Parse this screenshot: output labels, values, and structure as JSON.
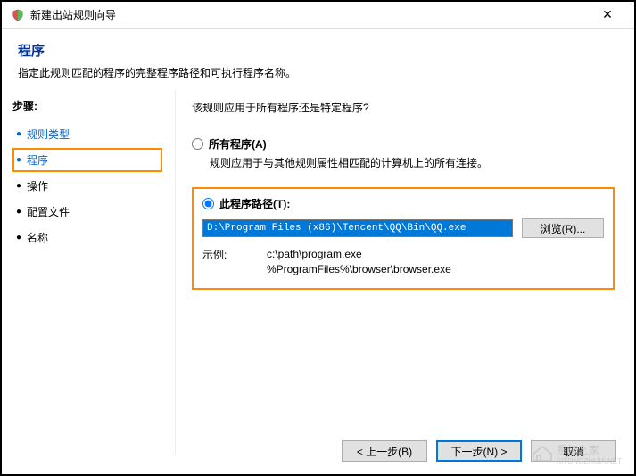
{
  "titlebar": {
    "title": "新建出站规则向导",
    "close": "✕"
  },
  "header": {
    "title": "程序",
    "description": "指定此规则匹配的程序的完整程序路径和可执行程序名称。"
  },
  "sidebar": {
    "title": "步骤:",
    "items": [
      {
        "label": "规则类型",
        "active": false,
        "link": true
      },
      {
        "label": "程序",
        "active": true,
        "link": true
      },
      {
        "label": "操作",
        "active": false,
        "link": false
      },
      {
        "label": "配置文件",
        "active": false,
        "link": false
      },
      {
        "label": "名称",
        "active": false,
        "link": false
      }
    ]
  },
  "main": {
    "question": "该规则应用于所有程序还是特定程序?",
    "optionAll": {
      "label": "所有程序(A)",
      "desc": "规则应用于与其他规则属性相匹配的计算机上的所有连接。"
    },
    "optionPath": {
      "label": "此程序路径(T):",
      "value": "D:\\Program Files (x86)\\Tencent\\QQ\\Bin\\QQ.exe",
      "browse": "浏览(R)...",
      "exampleLabel": "示例:",
      "example1": "c:\\path\\program.exe",
      "example2": "%ProgramFiles%\\browser\\browser.exe"
    }
  },
  "footer": {
    "back": "< 上一步(B)",
    "next": "下一步(N) >",
    "cancel": "取消"
  },
  "watermark": {
    "text": "系统之家",
    "url": "XITONGZHIJIA.NET"
  }
}
